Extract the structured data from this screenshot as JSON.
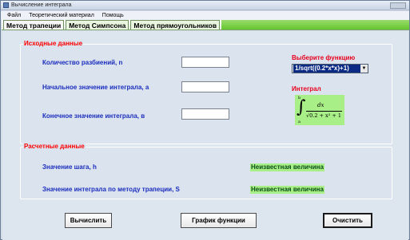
{
  "window": {
    "title": "Вычисление интеграла"
  },
  "menu": {
    "items": [
      "Файл",
      "Теоретический материал",
      "Помощь"
    ]
  },
  "tabs": [
    "Метод трапеции",
    "Метод Симпсона",
    "Метод прямоугольников"
  ],
  "input_group": {
    "label": "Исходные данные",
    "fields": [
      {
        "label": "Количество разбиений, n",
        "value": ""
      },
      {
        "label": "Начальное значение интеграла, a",
        "value": ""
      },
      {
        "label": "Конечное значение интеграла, в",
        "value": ""
      }
    ],
    "function_label": "Выберите функцию",
    "function_value": "1/sqrt((0.2*x*x)+1)",
    "integral_label": "Интеграл",
    "formula": {
      "upper": "b",
      "lower": "a",
      "numerator": "dx",
      "denominator": "√0.2 + x² + 1"
    }
  },
  "results_group": {
    "label": "Расчетные данные",
    "rows": [
      {
        "label": "Значение шага, h",
        "value": "Неизвестная величина"
      },
      {
        "label": "Значение интеграла по методу трапеции, S",
        "value": "Неизвестная величина"
      }
    ]
  },
  "buttons": {
    "calculate": "Вычислить",
    "plot": "График функции",
    "clear": "Очистить"
  }
}
